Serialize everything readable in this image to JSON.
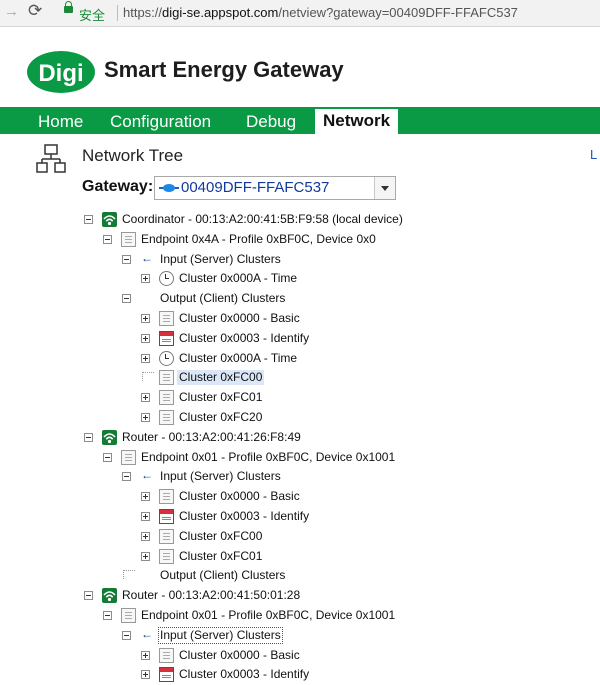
{
  "browser": {
    "secure_label": "安全",
    "url_scheme": "https://",
    "url_host": "digi-se.appspot.com",
    "url_path": "/netview?gateway=00409DFF-FFAFC537"
  },
  "header": {
    "logo_text": "Digi",
    "title": "Smart Energy Gateway"
  },
  "menu": {
    "tabs": [
      "Home",
      "Configuration",
      "Debug",
      "Network"
    ],
    "active": "Network"
  },
  "section": {
    "title": "Network Tree",
    "right_link": "L"
  },
  "gateway": {
    "label": "Gateway:",
    "value": "00409DFF-FFAFC537"
  },
  "tree": [
    {
      "level": 0,
      "toggle": "minus",
      "icon": "wifi",
      "label": "Coordinator - 00:13:A2:00:41:5B:F9:58 (local device)"
    },
    {
      "level": 1,
      "toggle": "minus",
      "icon": "page",
      "label": "Endpoint 0x4A - Profile 0xBF0C, Device 0x0"
    },
    {
      "level": 2,
      "toggle": "minus",
      "icon": "input",
      "label": "Input (Server) Clusters"
    },
    {
      "level": 3,
      "toggle": "plus",
      "icon": "clock",
      "label": "Cluster 0x000A - Time"
    },
    {
      "level": 2,
      "toggle": "minus",
      "icon": "output",
      "label": "Output (Client) Clusters"
    },
    {
      "level": 3,
      "toggle": "plus",
      "icon": "page",
      "label": "Cluster 0x0000 - Basic"
    },
    {
      "level": 3,
      "toggle": "plus",
      "icon": "badge",
      "label": "Cluster 0x0003 - Identify"
    },
    {
      "level": 3,
      "toggle": "plus",
      "icon": "clock",
      "label": "Cluster 0x000A - Time"
    },
    {
      "level": 3,
      "toggle": "none",
      "icon": "page",
      "label": "Cluster 0xFC00",
      "selected": true
    },
    {
      "level": 3,
      "toggle": "plus",
      "icon": "page",
      "label": "Cluster 0xFC01"
    },
    {
      "level": 3,
      "toggle": "plus",
      "icon": "page",
      "label": "Cluster 0xFC20"
    },
    {
      "level": 0,
      "toggle": "minus",
      "icon": "wifi",
      "label": "Router - 00:13:A2:00:41:26:F8:49"
    },
    {
      "level": 1,
      "toggle": "minus",
      "icon": "page",
      "label": "Endpoint 0x01 - Profile 0xBF0C, Device 0x1001"
    },
    {
      "level": 2,
      "toggle": "minus",
      "icon": "input",
      "label": "Input (Server) Clusters"
    },
    {
      "level": 3,
      "toggle": "plus",
      "icon": "page",
      "label": "Cluster 0x0000 - Basic"
    },
    {
      "level": 3,
      "toggle": "plus",
      "icon": "badge",
      "label": "Cluster 0x0003 - Identify"
    },
    {
      "level": 3,
      "toggle": "plus",
      "icon": "page",
      "label": "Cluster 0xFC00"
    },
    {
      "level": 3,
      "toggle": "plus",
      "icon": "page",
      "label": "Cluster 0xFC01"
    },
    {
      "level": 2,
      "toggle": "none",
      "icon": "output",
      "label": "Output (Client) Clusters"
    },
    {
      "level": 0,
      "toggle": "minus",
      "icon": "wifi",
      "label": "Router - 00:13:A2:00:41:50:01:28"
    },
    {
      "level": 1,
      "toggle": "minus",
      "icon": "page",
      "label": "Endpoint 0x01 - Profile 0xBF0C, Device 0x1001"
    },
    {
      "level": 2,
      "toggle": "minus",
      "icon": "input",
      "label": "Input (Server) Clusters",
      "focused": true
    },
    {
      "level": 3,
      "toggle": "plus",
      "icon": "page",
      "label": "Cluster 0x0000 - Basic"
    },
    {
      "level": 3,
      "toggle": "plus",
      "icon": "badge",
      "label": "Cluster 0x0003 - Identify"
    }
  ],
  "colors": {
    "menu_green": "#0a9a45",
    "link_blue": "#1a56b5"
  }
}
